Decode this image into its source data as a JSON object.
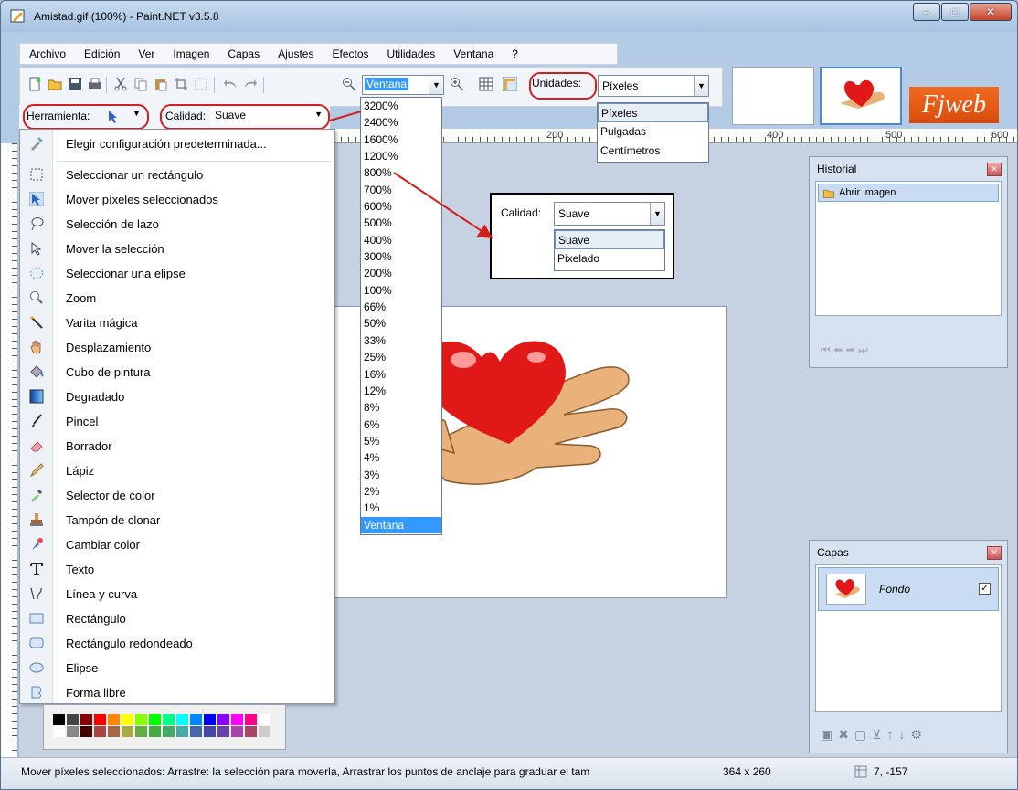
{
  "window": {
    "title": "Amistad.gif (100%) - Paint.NET v3.5.8"
  },
  "menu": [
    "Archivo",
    "Edición",
    "Ver",
    "Imagen",
    "Capas",
    "Ajustes",
    "Efectos",
    "Utilidades",
    "Ventana",
    "?"
  ],
  "toolbar": {
    "zoom_value": "Ventana",
    "units_label": "Unidades:",
    "units_value": "Píxeles"
  },
  "toolbar2": {
    "tool_label": "Herramienta:",
    "quality_label": "Calidad:",
    "quality_value": "Suave"
  },
  "ruler": {
    "unit": "px",
    "marks": [
      "200",
      "400",
      "500",
      "600"
    ]
  },
  "tools_menu": {
    "default_settings": "Elegir configuración predeterminada...",
    "items": [
      "Seleccionar un rectángulo",
      "Mover píxeles seleccionados",
      "Selección de lazo",
      "Mover la selección",
      "Seleccionar una elipse",
      "Zoom",
      "Varita mágica",
      "Desplazamiento",
      "Cubo de pintura",
      "Degradado",
      "Pincel",
      "Borrador",
      "Lápiz",
      "Selector de color",
      "Tampón de clonar",
      "Cambiar color",
      "Texto",
      "Línea y curva",
      "Rectángulo",
      "Rectángulo redondeado",
      "Elipse",
      "Forma libre"
    ]
  },
  "zoom_options": [
    "3200%",
    "2400%",
    "1600%",
    "1200%",
    "800%",
    "700%",
    "600%",
    "500%",
    "400%",
    "300%",
    "200%",
    "100%",
    "66%",
    "50%",
    "33%",
    "25%",
    "16%",
    "12%",
    "8%",
    "6%",
    "5%",
    "4%",
    "3%",
    "2%",
    "1%",
    "Ventana"
  ],
  "units_options": [
    "Píxeles",
    "Pulgadas",
    "Centímetros"
  ],
  "callout": {
    "label": "Calidad:",
    "value": "Suave",
    "options": [
      "Suave",
      "Pixelado"
    ]
  },
  "thumbnails": {
    "brand_text": "Fjweb"
  },
  "history": {
    "title": "Historial",
    "items": [
      "Abrir imagen"
    ]
  },
  "layers": {
    "title": "Capas",
    "items": [
      "Fondo"
    ]
  },
  "status": {
    "message": "Mover píxeles seleccionados: Arrastre: la selección para moverla, Arrastrar los puntos de anclaje para graduar el tam",
    "size": "364 x 260",
    "position": "7, -157"
  },
  "colors": {
    "accent": "#3399ff",
    "annotation_red": "#d02020"
  }
}
